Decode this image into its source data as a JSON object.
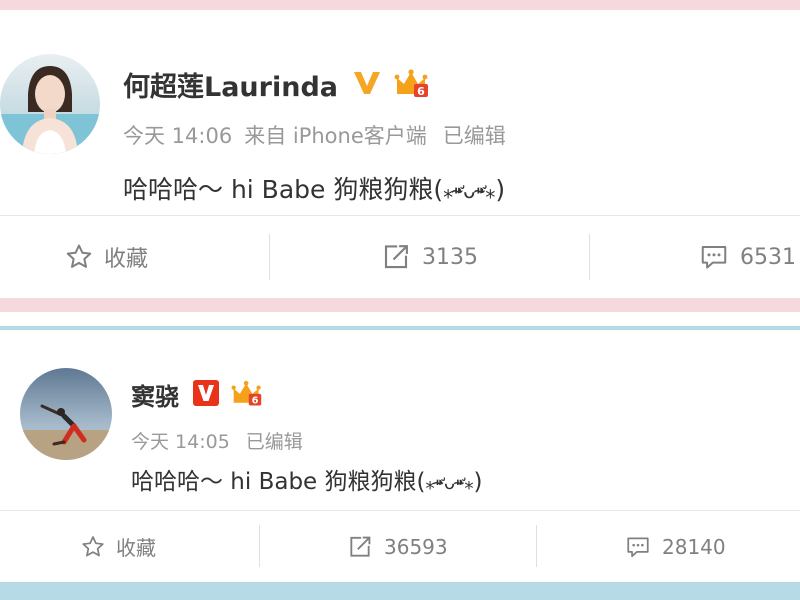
{
  "posts": [
    {
      "username": "何超莲Laurinda",
      "verify_icon": "gold-v-verified-icon",
      "vip_icon": "vip-crown-level-6-icon",
      "vip_level": "6",
      "time": "今天 14:06",
      "source": "来自 iPhone客户端",
      "edited": "已编辑",
      "text": "哈哈哈～ hi Babe 狗粮狗粮(",
      "kaomoji": "⁎⁍̴̛ᴗ⁍̴̛⁎",
      "text_end": ")",
      "favorite_label": "收藏",
      "repost_count": "3135",
      "comment_count": "6531"
    },
    {
      "username": "窦骁",
      "verify_icon": "red-v-verified-icon",
      "vip_icon": "vip-crown-level-6-icon",
      "vip_level": "6",
      "time": "今天 14:05",
      "edited": "已编辑",
      "text": "哈哈哈～ hi Babe 狗粮狗粮(",
      "kaomoji": "⁎⁍̴̛ᴗ⁍̴̛⁎",
      "text_end": ")",
      "favorite_label": "收藏",
      "repost_count": "36593",
      "comment_count": "28140"
    }
  ],
  "colors": {
    "band_pink": "#f6d9dd",
    "band_blue": "#b7dbe6",
    "gold_verify": "#f5a623",
    "red_verify": "#e8331a",
    "muted_text": "#999999",
    "action_text": "#808080"
  }
}
